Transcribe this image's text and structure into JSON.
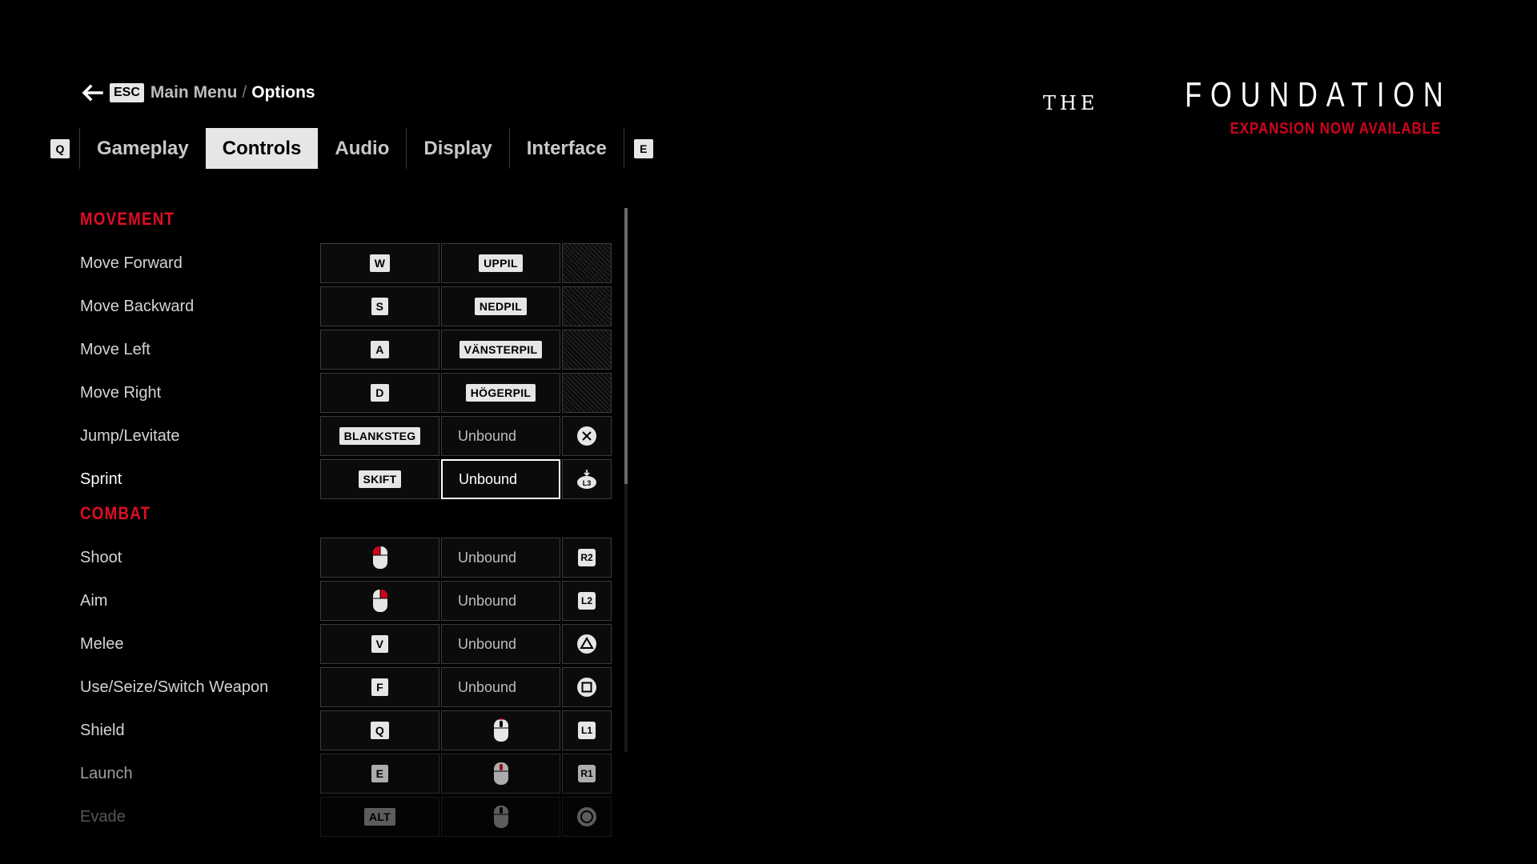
{
  "breadcrumb": {
    "esc_key": "ESC",
    "main_menu": "Main Menu",
    "separator": "/",
    "current": "Options"
  },
  "tabs": {
    "prev_key": "Q",
    "next_key": "E",
    "items": [
      {
        "label": "Gameplay",
        "active": false
      },
      {
        "label": "Controls",
        "active": true
      },
      {
        "label": "Audio",
        "active": false
      },
      {
        "label": "Display",
        "active": false
      },
      {
        "label": "Interface",
        "active": false
      }
    ]
  },
  "logo": {
    "the": "THE",
    "word": "FOUNDATION",
    "subtitle": "EXPANSION NOW AVAILABLE",
    "accent": "#d0021b"
  },
  "sections": {
    "movement": {
      "title": "MOVEMENT",
      "rows": [
        {
          "label": "Move Forward",
          "key1": "W",
          "key2": "UPPIL",
          "pad": "none"
        },
        {
          "label": "Move Backward",
          "key1": "S",
          "key2": "NEDPIL",
          "pad": "none"
        },
        {
          "label": "Move Left",
          "key1": "A",
          "key2": "VÄNSTERPIL",
          "pad": "none"
        },
        {
          "label": "Move Right",
          "key1": "D",
          "key2": "HÖGERPIL",
          "pad": "none"
        },
        {
          "label": "Jump/Levitate",
          "key1": "BLANKSTEG",
          "key2": "Unbound",
          "pad": "cross-icon"
        },
        {
          "label": "Sprint",
          "key1": "SKIFT",
          "key2": "Unbound",
          "pad": "L3"
        }
      ]
    },
    "combat": {
      "title": "COMBAT",
      "rows": [
        {
          "label": "Shoot",
          "key1": "mouse-left-icon",
          "key2": "Unbound",
          "pad": "R2"
        },
        {
          "label": "Aim",
          "key1": "mouse-right-icon",
          "key2": "Unbound",
          "pad": "L2"
        },
        {
          "label": "Melee",
          "key1": "V",
          "key2": "Unbound",
          "pad": "triangle-icon"
        },
        {
          "label": "Use/Seize/Switch Weapon",
          "key1": "F",
          "key2": "Unbound",
          "pad": "square-icon"
        },
        {
          "label": "Shield",
          "key1": "Q",
          "key2": "mouse-wheel-up-icon",
          "pad": "L1"
        },
        {
          "label": "Launch",
          "key1": "E",
          "key2": "mouse-wheel-click-icon",
          "pad": "R1"
        },
        {
          "label": "Evade",
          "key1": "ALT",
          "key2": "mouse-wheel-down-icon",
          "pad": "circle-icon"
        }
      ]
    }
  }
}
